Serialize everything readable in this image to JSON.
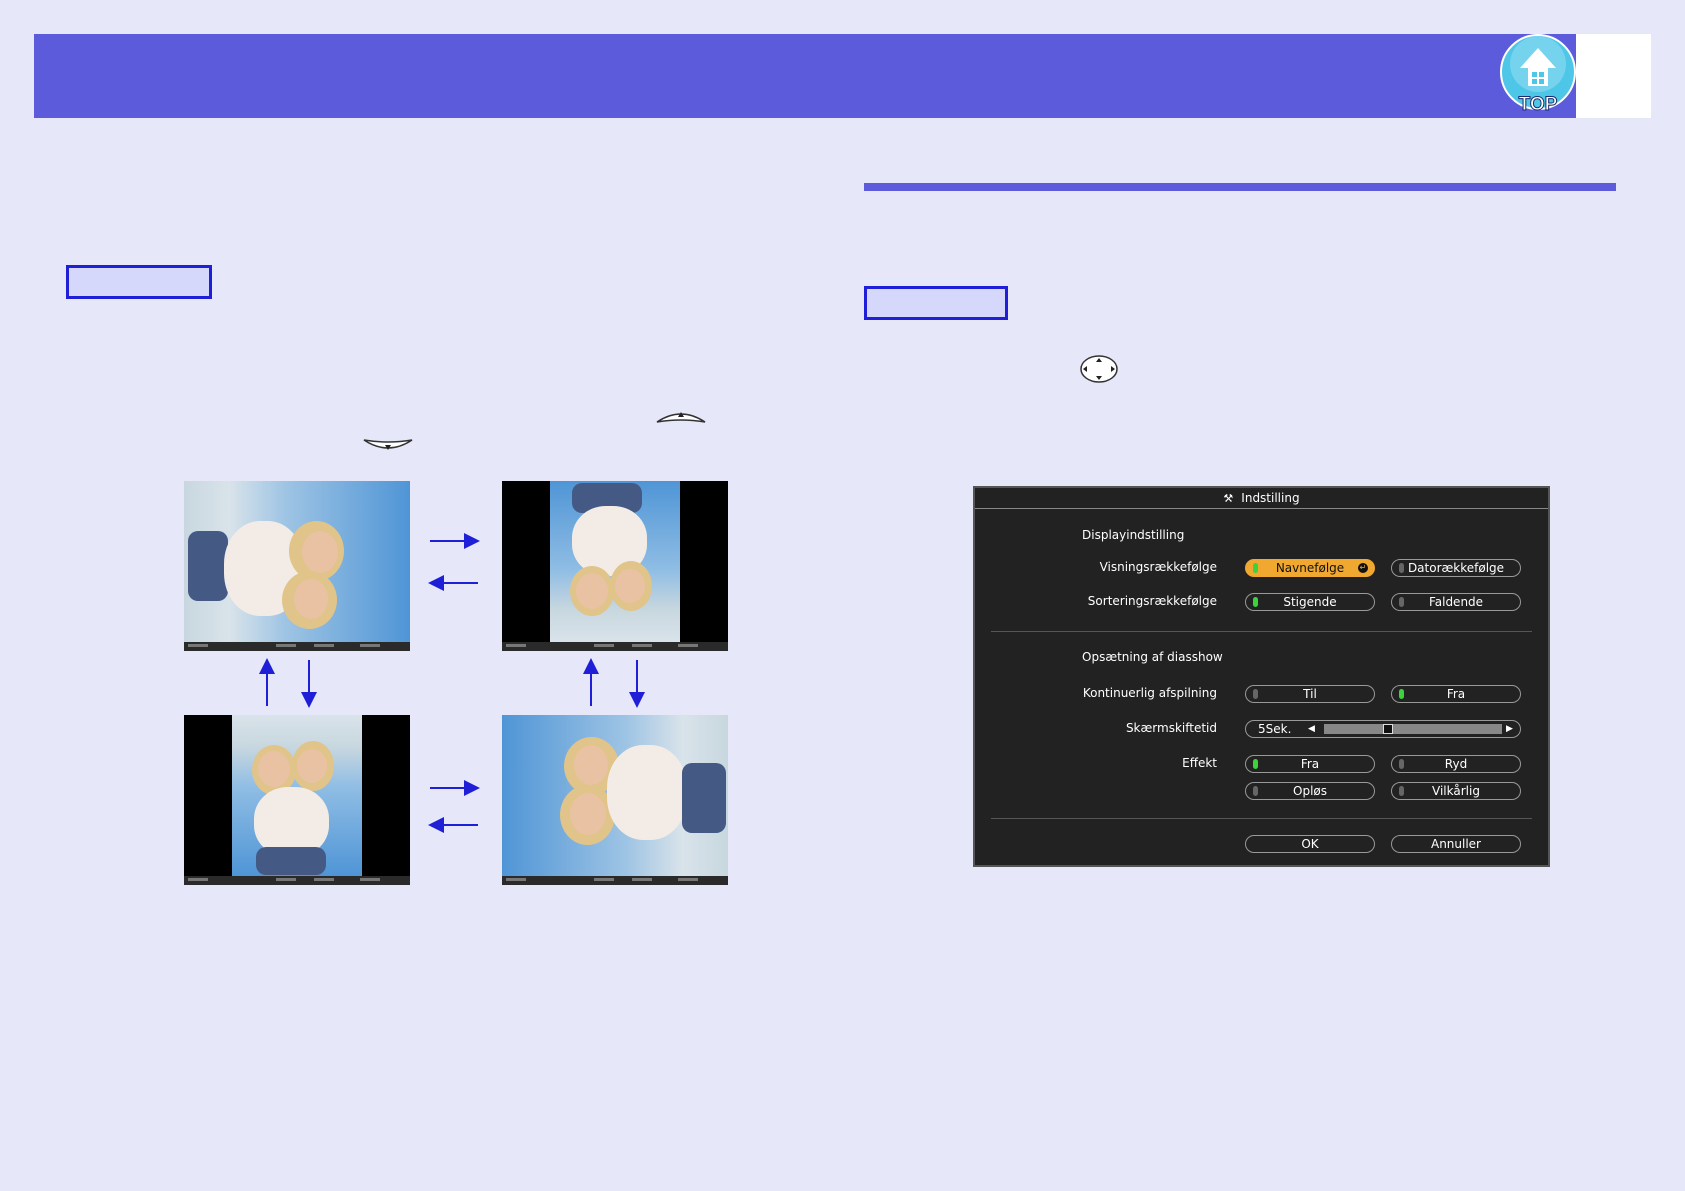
{
  "header": {
    "top_button_label": "TOP"
  },
  "dialog": {
    "title": "Indstilling",
    "section_display": "Displayindstilling",
    "display_order": {
      "label": "Visningsrækkefølge",
      "options": [
        "Navnefølge",
        "Datorækkefølge"
      ]
    },
    "sort_order": {
      "label": "Sorteringsrækkefølge",
      "options": [
        "Stigende",
        "Faldende"
      ]
    },
    "section_slideshow": "Opsætning af diasshow",
    "continuous": {
      "label": "Kontinuerlig afspilning",
      "options": [
        "Til",
        "Fra"
      ]
    },
    "screen_time": {
      "label": "Skærmskiftetid",
      "value": "5Sek.",
      "slider_fraction": 0.35
    },
    "effect": {
      "label": "Effekt",
      "options": [
        "Fra",
        "Ryd",
        "Opløs",
        "Vilkårlig"
      ]
    },
    "ok_label": "OK",
    "cancel_label": "Annuller"
  }
}
